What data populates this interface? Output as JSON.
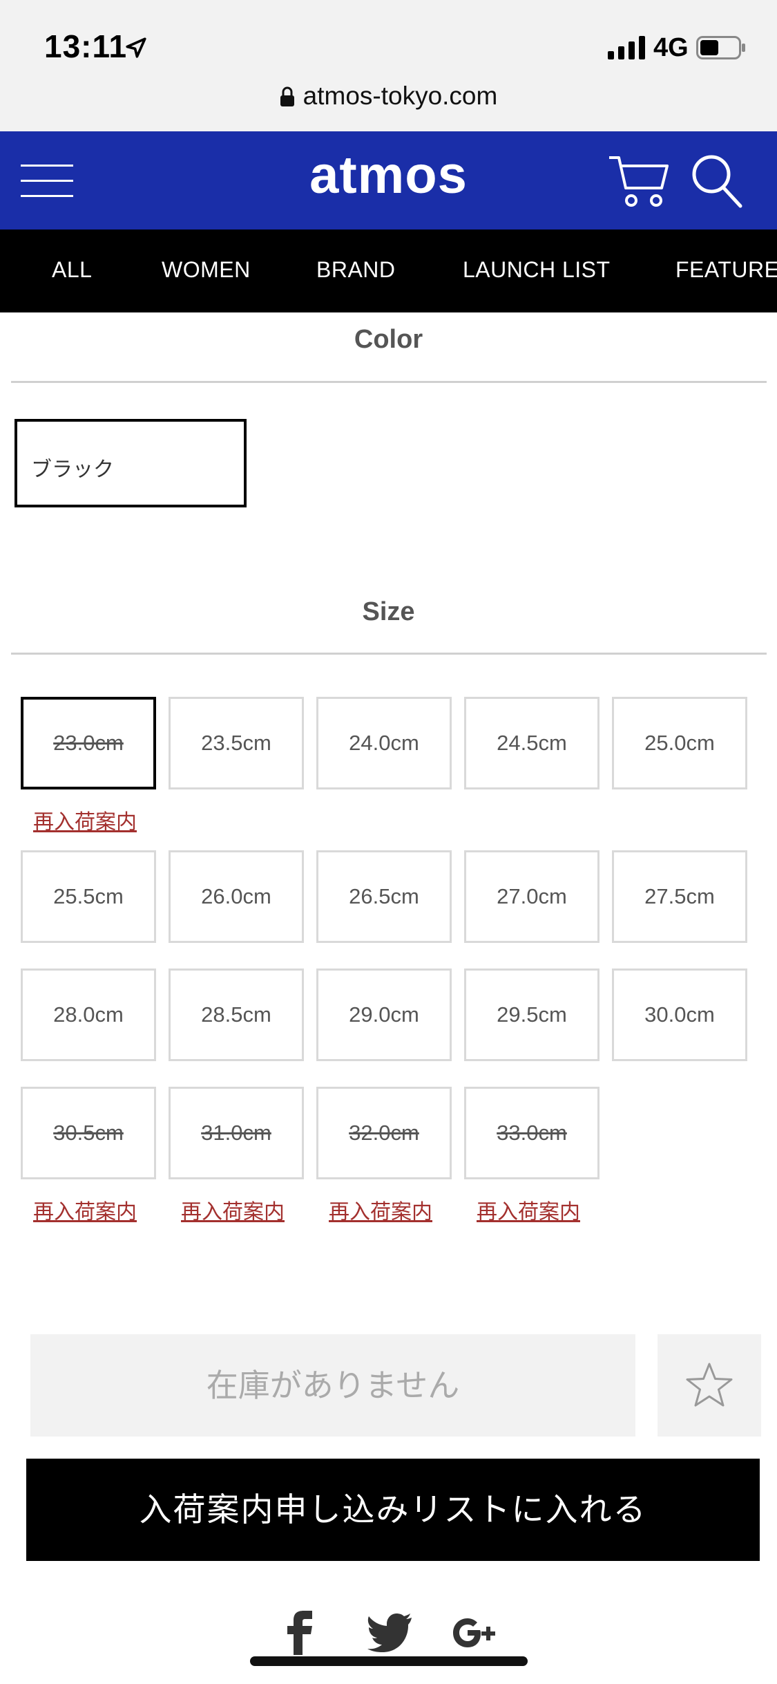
{
  "status": {
    "time": "13:11",
    "network": "4G",
    "url": "atmos-tokyo.com"
  },
  "header": {
    "logo": "atmos"
  },
  "nav": {
    "items": [
      "ALL",
      "WOMEN",
      "BRAND",
      "LAUNCH LIST",
      "FEATURES"
    ]
  },
  "color_section": {
    "title": "Color",
    "options": [
      "ブラック"
    ],
    "selected": "ブラック"
  },
  "size_section": {
    "title": "Size",
    "selected": "23.0cm",
    "restock_label": "再入荷案内",
    "sizes": [
      {
        "label": "23.0cm",
        "available": false
      },
      {
        "label": "23.5cm",
        "available": true
      },
      {
        "label": "24.0cm",
        "available": true
      },
      {
        "label": "24.5cm",
        "available": true
      },
      {
        "label": "25.0cm",
        "available": true
      },
      {
        "label": "25.5cm",
        "available": true
      },
      {
        "label": "26.0cm",
        "available": true
      },
      {
        "label": "26.5cm",
        "available": true
      },
      {
        "label": "27.0cm",
        "available": true
      },
      {
        "label": "27.5cm",
        "available": true
      },
      {
        "label": "28.0cm",
        "available": true
      },
      {
        "label": "28.5cm",
        "available": true
      },
      {
        "label": "29.0cm",
        "available": true
      },
      {
        "label": "29.5cm",
        "available": true
      },
      {
        "label": "30.0cm",
        "available": true
      },
      {
        "label": "30.5cm",
        "available": false
      },
      {
        "label": "31.0cm",
        "available": false
      },
      {
        "label": "32.0cm",
        "available": false
      },
      {
        "label": "33.0cm",
        "available": false
      }
    ]
  },
  "actions": {
    "out_of_stock": "在庫がありません",
    "add_to_list": "入荷案内申し込みリストに入れる"
  },
  "colors": {
    "brand": "#1a2ea8",
    "restock_link": "#a3302e"
  },
  "icons": [
    "location-arrow-icon",
    "signal-icon",
    "battery-icon",
    "lock-icon",
    "menu-icon",
    "cart-icon",
    "search-icon",
    "star-icon",
    "facebook-icon",
    "twitter-icon",
    "google-plus-icon"
  ]
}
